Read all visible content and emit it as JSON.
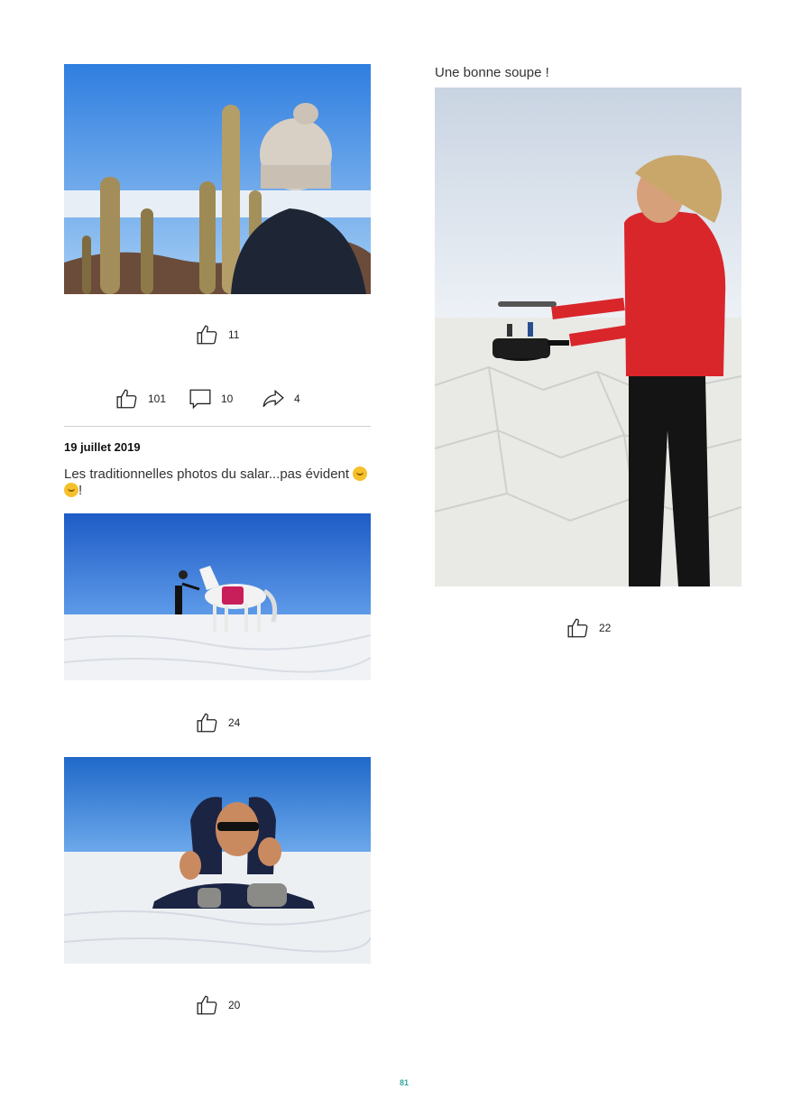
{
  "left_column": {
    "photo_cactus": {
      "likes": "11",
      "alt": "cactus-with-woman-photo"
    },
    "post_stats": {
      "likes": "101",
      "comments": "10",
      "shares": "4"
    },
    "post": {
      "date": "19 juillet 2019",
      "text_line1": "Les traditionnelles photos du salar...pas évident",
      "text_line2": "!"
    },
    "photo_horse": {
      "likes": "24"
    },
    "photo_legs": {
      "likes": "20"
    }
  },
  "right_column": {
    "caption": "Une bonne soupe !",
    "photo_soup": {
      "likes": "22"
    }
  },
  "footer": {
    "page_number": "81"
  },
  "colors": {
    "sky_top": "#2a6fd0",
    "salt_flat": "#eef0f3",
    "accent_page_number": "#3aa6a0",
    "divider": "#d0d0d0"
  }
}
